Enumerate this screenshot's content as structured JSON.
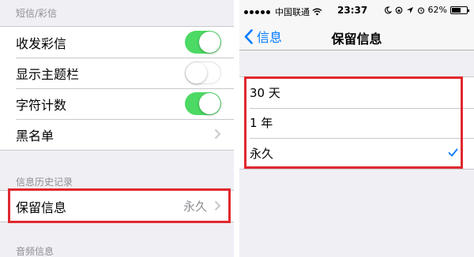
{
  "left_panel": {
    "sms_header": "短信/彩信",
    "settings": [
      {
        "label": "收发彩信",
        "toggle": "on"
      },
      {
        "label": "显示主题栏",
        "toggle": "off"
      },
      {
        "label": "字符计数",
        "toggle": "on"
      },
      {
        "label": "黑名单"
      }
    ],
    "history_header": "信息历史记录",
    "keep_messages": {
      "label": "保留信息",
      "value": "永久"
    },
    "audio_header": "音频信息"
  },
  "status_bar": {
    "carrier": "中国联通",
    "time": "23:37",
    "battery_percent": "62%",
    "battery_level": 0.62
  },
  "nav": {
    "back_label": "信息",
    "title": "保留信息"
  },
  "options": [
    {
      "label": "30 天",
      "selected": false
    },
    {
      "label": "1 年",
      "selected": false
    },
    {
      "label": "永久",
      "selected": true
    }
  ],
  "colors": {
    "toggle_on": "#4cd964",
    "accent": "#007aff",
    "highlight": "#e0282e"
  }
}
